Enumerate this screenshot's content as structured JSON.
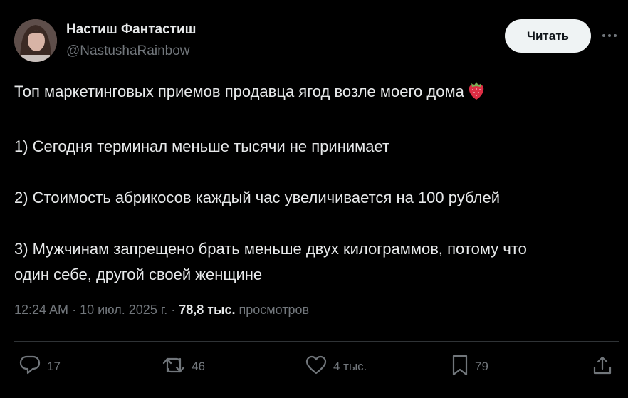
{
  "author": {
    "name": "Настиш Фантастиш",
    "handle": "@NastushaRainbow"
  },
  "follow_button_label": "Читать",
  "tweet": {
    "lines": [
      "Топ маркетинговых приемов продавца ягод возле моего дома",
      "1) Сегодня терминал меньше тысячи не принимает",
      "2) Стоимость абрикосов каждый час увеличивается на 100 рублей",
      "3) Мужчинам запрещено брать меньше двух килограммов, потому что",
      "один себе, другой своей женщине"
    ],
    "emoji": "strawberry-icon"
  },
  "meta": {
    "time": "12:24 AM",
    "separator": "·",
    "date": "10 июл. 2025 г.",
    "views_count": "78,8 тыс.",
    "views_label": "просмотров"
  },
  "actions": {
    "replies": "17",
    "reposts": "46",
    "likes": "4 тыс.",
    "bookmarks": "79"
  },
  "colors": {
    "background": "#000000",
    "text": "#e7e9ea",
    "secondary": "#71767b",
    "divider": "#2f3336",
    "button_bg": "#eff3f4"
  }
}
